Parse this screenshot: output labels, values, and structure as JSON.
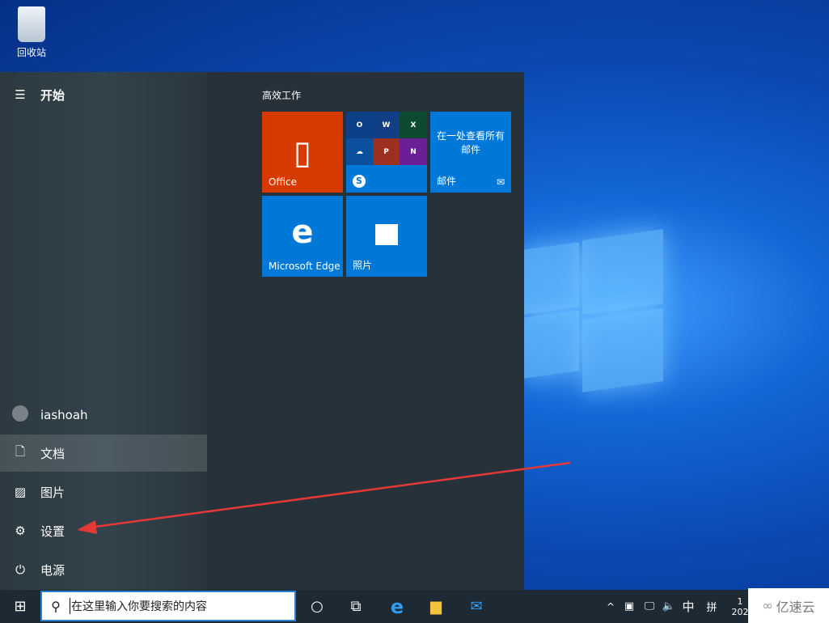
{
  "desktop": {
    "recycle_bin": "回收站"
  },
  "start_menu": {
    "header": "开始",
    "user": "iashoah",
    "items": [
      {
        "label": "文档",
        "icon": "document-icon"
      },
      {
        "label": "图片",
        "icon": "pictures-icon"
      },
      {
        "label": "设置",
        "icon": "gear-icon"
      },
      {
        "label": "电源",
        "icon": "power-icon"
      }
    ],
    "group_title": "高效工作",
    "tiles": {
      "office": "Office",
      "mail_text": "在一处查看所有邮件",
      "mail": "邮件",
      "edge": "Microsoft Edge",
      "photos": "照片"
    },
    "office_apps": [
      "O",
      "W",
      "X",
      "☁",
      "P",
      "N"
    ]
  },
  "taskbar": {
    "search_placeholder": "在这里输入你要搜索的内容",
    "ime": "中",
    "ime_mode": "拼",
    "clock_top": "1",
    "clock_bottom": "202"
  },
  "watermark": "亿速云",
  "colors": {
    "accent": "#0078d7",
    "office": "#d83b01",
    "arrow": "#e53935"
  }
}
